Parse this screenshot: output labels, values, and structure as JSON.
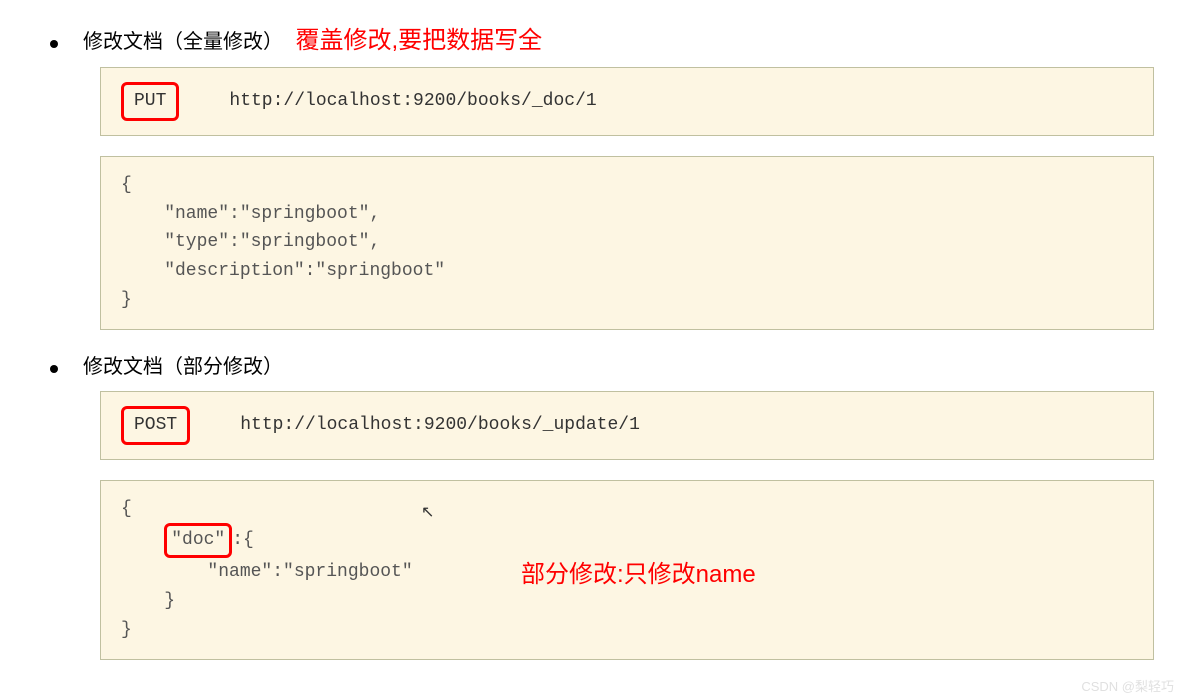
{
  "section1": {
    "bullet_text": "修改文档（全量修改）",
    "annotation": "覆盖修改,要把数据写全",
    "method": "PUT",
    "url": "http://localhost:9200/books/_doc/1",
    "body_line1": "{",
    "body_line2": "    \"name\":\"springboot\",",
    "body_line3": "    \"type\":\"springboot\",",
    "body_line4": "    \"description\":\"springboot\"",
    "body_line5": "}"
  },
  "section2": {
    "bullet_text": "修改文档（部分修改）",
    "method": "POST",
    "url": "http://localhost:9200/books/_update/1",
    "body_line1": "{",
    "body_doc_key": "\"doc\"",
    "body_line2_after": ":{",
    "body_line3": "        \"name\":\"springboot\"",
    "body_line4": "    }",
    "body_line5": "}",
    "annotation": "部分修改:只修改name"
  },
  "watermark": "CSDN @梨轻巧"
}
